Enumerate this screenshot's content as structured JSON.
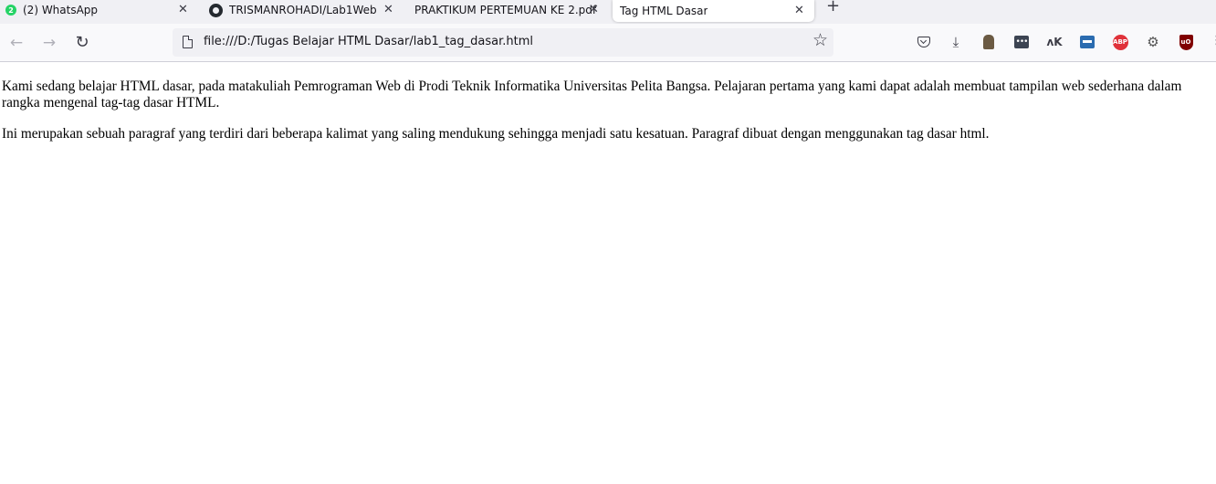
{
  "tabs": [
    {
      "title": "(2) WhatsApp",
      "badge": "2",
      "icon": "whatsapp-icon",
      "close": "✕"
    },
    {
      "title": "TRISMANROHADI/Lab1Web",
      "icon": "github-icon",
      "close": "✕"
    },
    {
      "title": "PRAKTIKUM PERTEMUAN KE 2.pdf",
      "icon": "none",
      "close": "✕"
    },
    {
      "title": "Tag HTML Dasar",
      "icon": "none",
      "close": "✕",
      "active": true
    }
  ],
  "new_tab_glyph": "+",
  "nav": {
    "back_glyph": "←",
    "forward_glyph": "→",
    "reload_glyph": "↻",
    "url": "file:///D:/Tugas Belajar HTML Dasar/lab1_tag_dasar.html",
    "bookmark_glyph": "☆"
  },
  "extensions": [
    {
      "name": "pocket-icon"
    },
    {
      "name": "download-icon",
      "glyph": "⤓"
    },
    {
      "name": "profile-extension-icon"
    },
    {
      "name": "dots-extension-icon",
      "glyph": "•••"
    },
    {
      "name": "ak-extension-icon",
      "glyph": "ʌK"
    },
    {
      "name": "box-extension-icon"
    },
    {
      "name": "adblock-plus-icon",
      "glyph": "ABP"
    },
    {
      "name": "settings-extension-icon",
      "glyph": "⚙"
    },
    {
      "name": "ublock-origin-icon",
      "glyph": "uO"
    }
  ],
  "menu_glyph": "⋮",
  "page": {
    "paragraphs": [
      "Kami sedang belajar HTML dasar, pada matakuliah Pemrograman Web di Prodi Teknik Informatika Universitas Pelita Bangsa. Pelajaran pertama yang kami dapat adalah membuat tampilan web sederhana dalam rangka mengenal tag-tag dasar HTML.",
      "Ini merupakan sebuah paragraf yang terdiri dari beberapa kalimat yang saling mendukung sehingga menjadi satu kesatuan. Paragraf dibuat dengan menggunakan tag dasar html."
    ]
  },
  "colors": {
    "tabstrip_bg": "#f0f0f4",
    "toolbar_bg": "#f9f9fb",
    "urlbar_bg": "#f0f0f4",
    "whatsapp_green": "#25d366",
    "abp_red": "#e0323a",
    "ublock_red": "#800000"
  }
}
